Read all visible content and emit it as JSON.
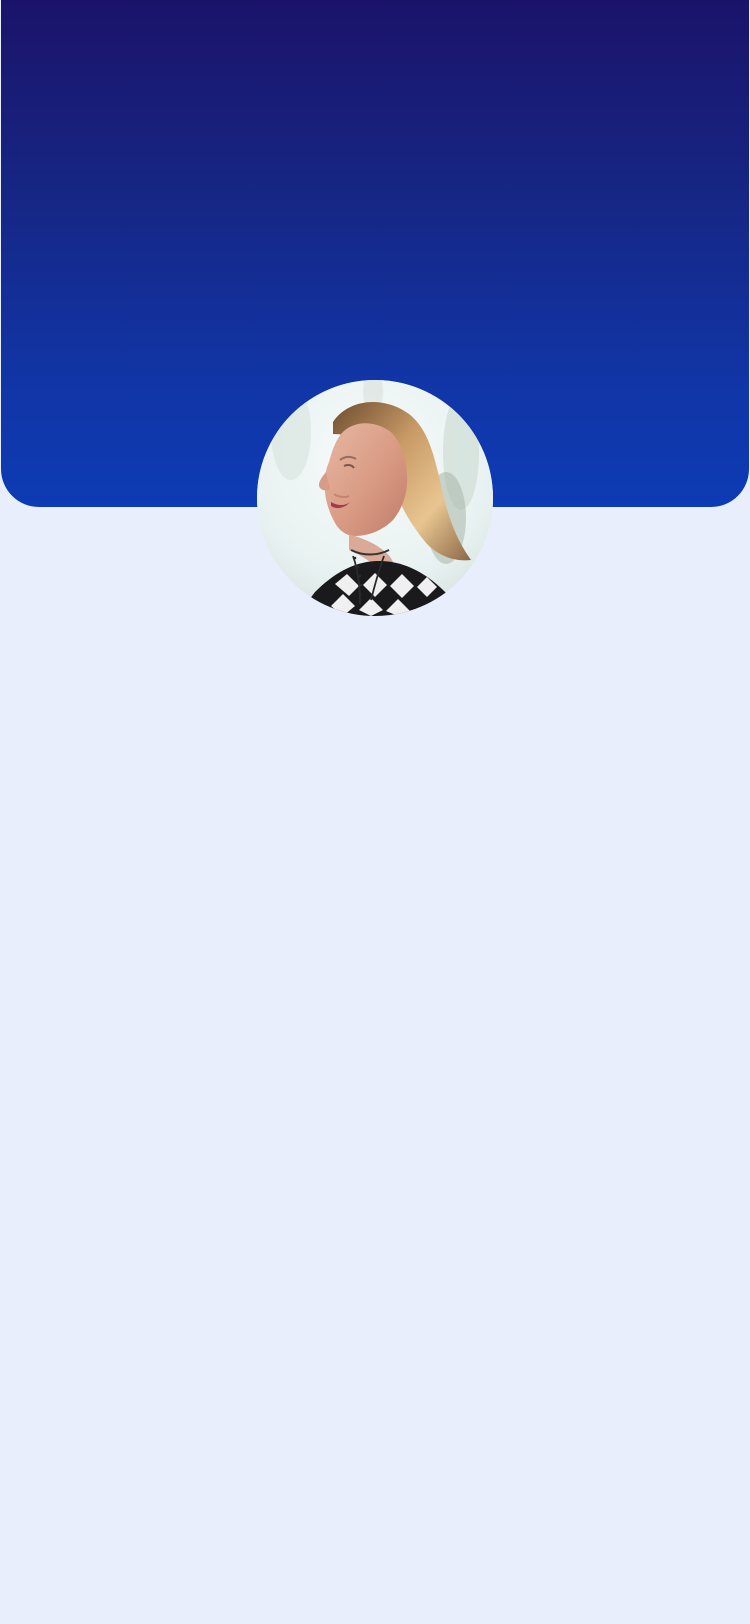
{
  "screen": {
    "background_color": "#E8EEFB"
  },
  "header": {
    "gradient_colors": [
      "#1B136A",
      "#162684",
      "#1135A6",
      "#0D3BB4"
    ]
  },
  "profile": {
    "avatar_icon": "profile-photo-portrait"
  }
}
